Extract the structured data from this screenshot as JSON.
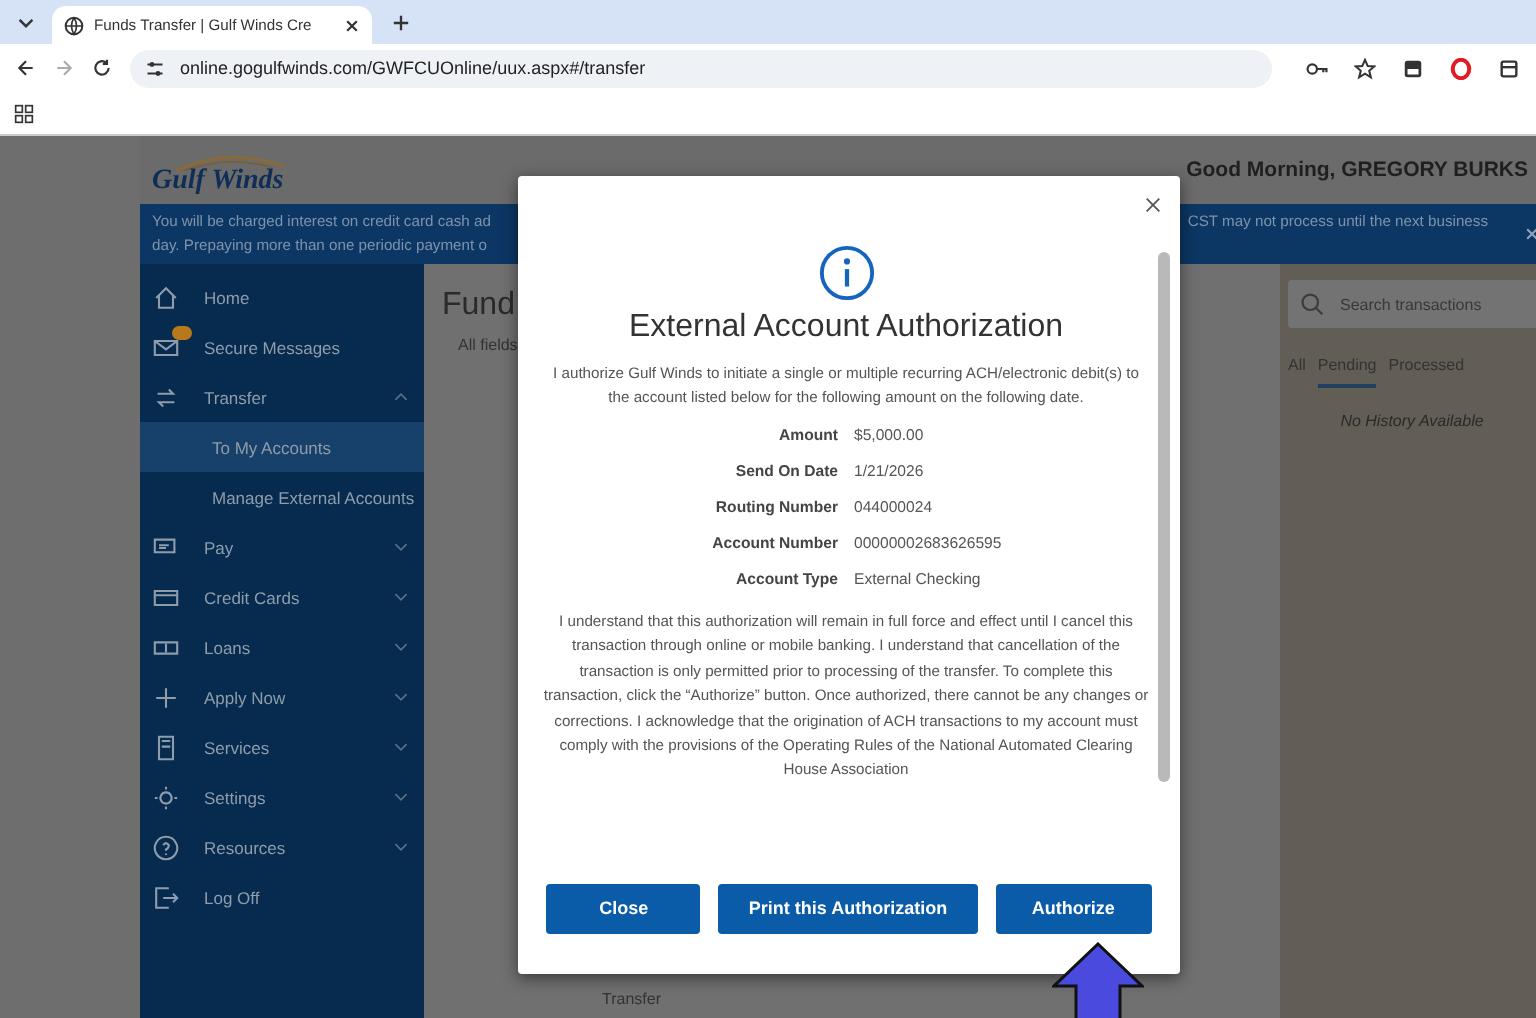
{
  "browser": {
    "tab_title": "Funds Transfer | Gulf Winds Cre",
    "url": "online.gogulfwinds.com/GWFCUOnline/uux.aspx#/transfer"
  },
  "header": {
    "logo": "Gulf Winds",
    "greeting": "Good Morning, GREGORY BURKS"
  },
  "banner": {
    "left_lines": [
      "You will be charged interest on credit card cash ad",
      "day. Prepaying more than one periodic payment o"
    ],
    "right_text": "CST may not process until the next business"
  },
  "sidebar": {
    "items": [
      {
        "label": "Home",
        "kind": "link"
      },
      {
        "label": "Secure Messages",
        "kind": "link",
        "unread": true
      },
      {
        "label": "Transfer",
        "kind": "group",
        "expanded": true,
        "children": [
          {
            "label": "To My Accounts",
            "selected": true
          },
          {
            "label": "Manage External Accounts",
            "selected": false
          }
        ]
      },
      {
        "label": "Pay",
        "kind": "group",
        "expanded": false
      },
      {
        "label": "Credit Cards",
        "kind": "group",
        "expanded": false
      },
      {
        "label": "Loans",
        "kind": "group",
        "expanded": false
      },
      {
        "label": "Apply Now",
        "kind": "group",
        "expanded": false
      },
      {
        "label": "Services",
        "kind": "group",
        "expanded": false
      },
      {
        "label": "Settings",
        "kind": "group",
        "expanded": false
      },
      {
        "label": "Resources",
        "kind": "group",
        "expanded": false
      },
      {
        "label": "Log Off",
        "kind": "link"
      }
    ]
  },
  "main": {
    "title": "Fund",
    "subtitle": "All fields",
    "row_label": "Transfer"
  },
  "history": {
    "search": {
      "placeholder": "Search transactions"
    },
    "tabs": [
      {
        "label": "All",
        "selected": false
      },
      {
        "label": "Pending",
        "selected": true
      },
      {
        "label": "Processed",
        "selected": false
      }
    ],
    "empty": "No History Available"
  },
  "modal": {
    "title": "External Account Authorization",
    "intro": "I authorize Gulf Winds to initiate a single or multiple recurring ACH/electronic debit(s) to the account listed below for the following amount on the following date.",
    "details": [
      {
        "label": "Amount",
        "value": "$5,000.00"
      },
      {
        "label": "Send On Date",
        "value": "1/21/2026"
      },
      {
        "label": "Routing Number",
        "value": "044000024"
      },
      {
        "label": "Account Number",
        "value": "00000002683626595"
      },
      {
        "label": "Account Type",
        "value": "External Checking"
      }
    ],
    "terms": "I understand that this authorization will remain in full force and effect until I cancel this transaction through online or mobile banking. I understand that cancellation of the transaction is only permitted prior to processing of the transfer. To complete this transaction, click the “Authorize” button. Once authorized, there cannot be any changes or corrections. I acknowledge that the origination of ACH transactions to my account must comply with the provisions of the Operating Rules of the National Automated Clearing House Association",
    "buttons": [
      {
        "label": "Close"
      },
      {
        "label": "Print this Authorization"
      },
      {
        "label": "Authorize"
      }
    ]
  }
}
